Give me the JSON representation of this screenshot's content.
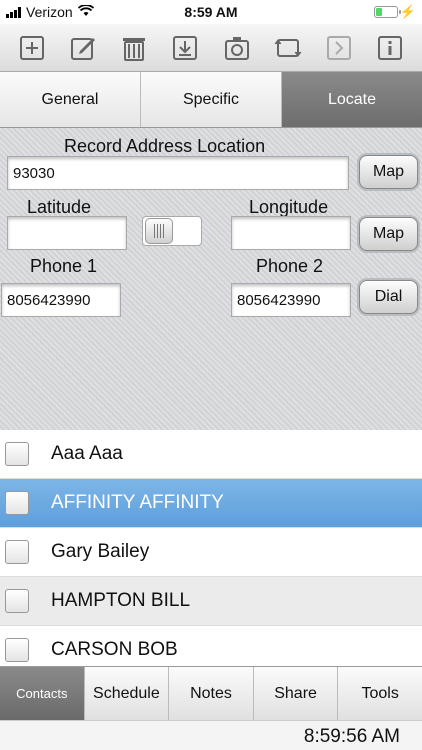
{
  "status": {
    "carrier": "Verizon",
    "time": "8:59 AM",
    "icons": [
      "signal-icon",
      "wifi-icon",
      "battery-icon",
      "charging-bolt-icon"
    ],
    "battery_level": 0.3
  },
  "toolbar": {
    "icons": [
      "add-icon",
      "edit-icon",
      "trash-icon",
      "download-icon",
      "camera-icon",
      "sync-icon",
      "forward-icon",
      "info-icon"
    ]
  },
  "tabs": [
    {
      "label": "General",
      "active": false
    },
    {
      "label": "Specific",
      "active": false
    },
    {
      "label": "Locate",
      "active": true
    }
  ],
  "form": {
    "record_label": "Record Address Location",
    "address_value": "93030",
    "map_label": "Map",
    "latitude_label": "Latitude",
    "longitude_label": "Longitude",
    "latitude_value": "",
    "longitude_value": "",
    "phone1_label": "Phone 1",
    "phone2_label": "Phone 2",
    "phone1_value": "8056423990",
    "phone2_value": "8056423990",
    "dial_label": "Dial"
  },
  "contacts": [
    {
      "name": "Aaa Aaa",
      "checked": false,
      "selected": false
    },
    {
      "name": "AFFINITY AFFINITY",
      "checked": false,
      "selected": true
    },
    {
      "name": "Gary Bailey",
      "checked": false,
      "selected": false
    },
    {
      "name": "HAMPTON BILL",
      "checked": false,
      "selected": false
    },
    {
      "name": "CARSON BOB",
      "checked": false,
      "selected": false
    }
  ],
  "bottom_tabs": [
    {
      "label": "Contacts",
      "active": true
    },
    {
      "label": "Schedule",
      "active": false
    },
    {
      "label": "Notes",
      "active": false
    },
    {
      "label": "Share",
      "active": false
    },
    {
      "label": "Tools",
      "active": false
    }
  ],
  "footer": {
    "clock": "8:59:56 AM"
  },
  "colors": {
    "selected_row": "#6aa8df",
    "active_tab": "#7c7c7c",
    "panel": "#d7d9dc"
  }
}
